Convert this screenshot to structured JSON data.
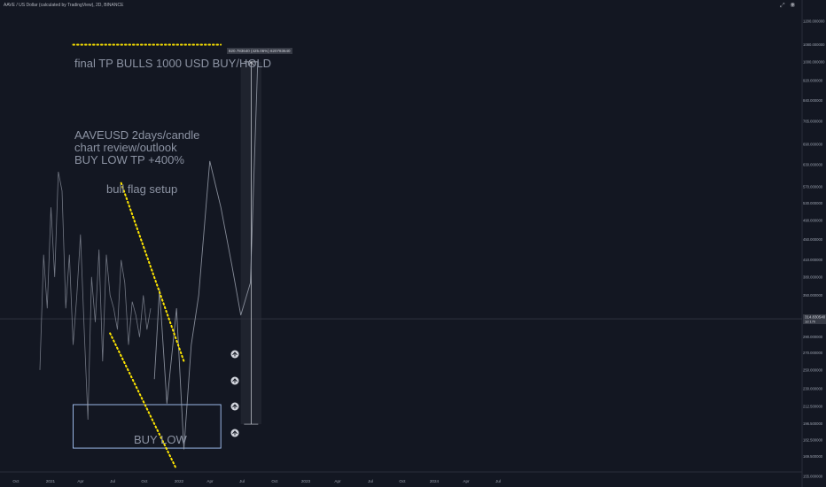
{
  "header": {
    "symbol_line": "AAVE / US Dollar (calculated by TradingView), 2D, BINANCE",
    "icons": [
      "expand-icon",
      "camera-icon"
    ]
  },
  "annotations": {
    "final_tp": "final TP BULLS 1000 USD BUY/HOLD",
    "review_lines": [
      "AAVEUSD 2days/candle",
      "chart review/outlook",
      "BUY LOW TP +400%"
    ],
    "bull_flag": "bull flag setup",
    "buy_low": "BUY LOW",
    "measure_label": "820.783640 (425.06%) 820783640"
  },
  "current_price": {
    "value": "314.830540",
    "sub": "1d 17h"
  },
  "colors": {
    "background": "#131722",
    "price_line": "#9aa0ad",
    "trendline": "#ffe600",
    "buy_box": "#a8c7fa",
    "projection_box": "#2a2e39",
    "text": "#8c93a3"
  },
  "chart_data": {
    "type": "line",
    "title": "AAVE / US Dollar (calculated by TradingView), 2D, BINANCE",
    "xlabel": "",
    "ylabel": "",
    "y_scale": "log",
    "ylim": [
      160,
      1300
    ],
    "x_ticks": [
      "Oct",
      "2021",
      "Apr",
      "Jul",
      "Oct",
      "2022",
      "Apr",
      "Jul",
      "Oct",
      "2023",
      "Apr",
      "Jul",
      "Oct",
      "2024",
      "Apr",
      "Jul"
    ],
    "y_ticks": [
      "1200.000000",
      "1080.000000",
      "1000.000000",
      "920.000000",
      "840.000000",
      "765.000000",
      "690.000000",
      "630.000000",
      "570.000000",
      "530.000000",
      "490.000000",
      "450.000000",
      "410.000000",
      "380.000000",
      "350.000000",
      "314.830540",
      "290.000000",
      "270.000000",
      "250.000000",
      "230.000000",
      "212.500000",
      "196.500000",
      "182.500000",
      "169.500000",
      "155.000000"
    ],
    "series": [
      {
        "type": "price",
        "x": [
          0.0,
          0.05,
          0.1,
          0.15,
          0.2,
          0.25,
          0.3,
          0.35,
          0.4,
          0.45,
          0.5,
          0.55,
          0.6,
          0.65,
          0.7,
          0.75,
          0.8,
          0.85,
          0.9,
          0.95,
          1.0,
          1.05,
          1.1,
          1.15,
          1.2,
          1.25,
          1.3,
          1.35,
          1.4,
          1.45,
          1.5
        ],
        "values": [
          250,
          420,
          330,
          520,
          380,
          610,
          560,
          330,
          420,
          280,
          350,
          460,
          300,
          200,
          380,
          310,
          430,
          260,
          420,
          350,
          330,
          300,
          410,
          370,
          280,
          340,
          320,
          290,
          350,
          300,
          330
        ]
      },
      {
        "type": "projection",
        "x": [
          1.55,
          1.62,
          1.72,
          1.85,
          1.95,
          2.05,
          2.15,
          2.3,
          2.45,
          2.6,
          2.72,
          2.85,
          2.95
        ],
        "values": [
          240,
          360,
          215,
          330,
          175,
          280,
          350,
          640,
          520,
          400,
          320,
          370,
          1000
        ]
      }
    ],
    "trendlines": [
      {
        "name": "upper",
        "points": [
          [
            1.1,
            580
          ],
          [
            1.95,
            260
          ]
        ]
      },
      {
        "name": "lower",
        "points": [
          [
            0.95,
            295
          ],
          [
            1.85,
            160
          ]
        ]
      },
      {
        "name": "target",
        "points": [
          [
            0.45,
            1080
          ],
          [
            2.45,
            1080
          ]
        ]
      }
    ],
    "zones": [
      {
        "name": "buy-low-box",
        "x": [
          0.45,
          2.45
        ],
        "ylim": [
          176,
          214
        ],
        "label": "BUY LOW"
      },
      {
        "name": "projection-range",
        "x": [
          2.72,
          3.0
        ],
        "ylim": [
          196,
          1000
        ]
      }
    ],
    "grid": false
  }
}
